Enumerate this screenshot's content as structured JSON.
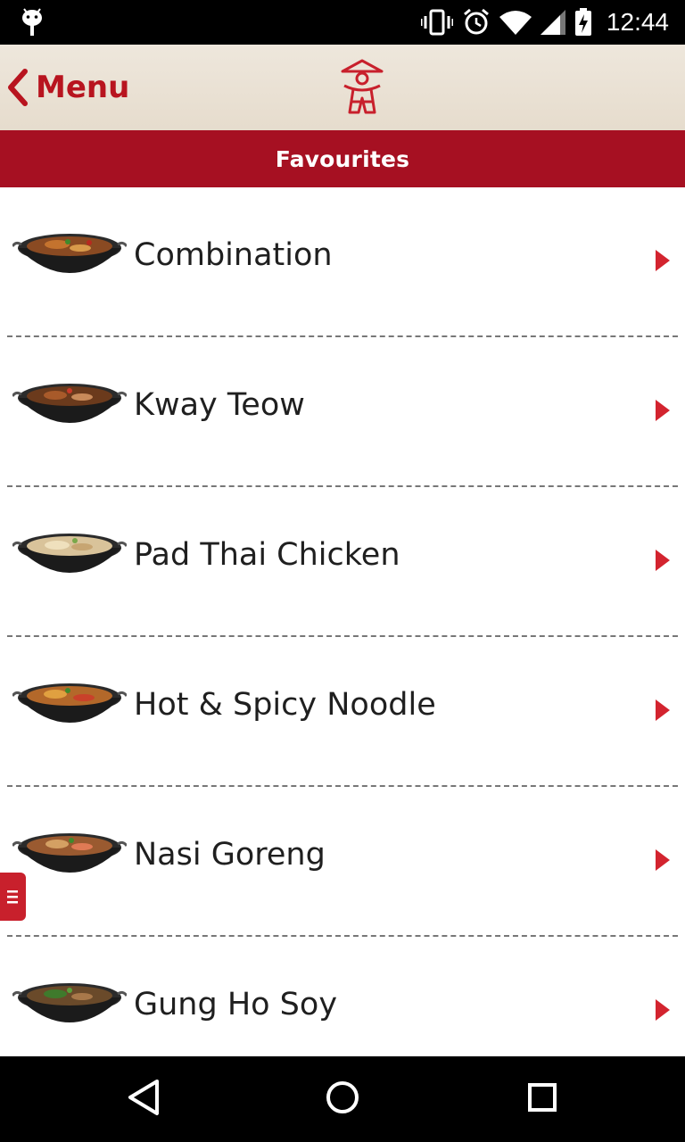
{
  "status_bar": {
    "time": "12:44",
    "icons": [
      "android-debug-icon",
      "vibrate-icon",
      "alarm-icon",
      "wifi-icon",
      "signal-icon",
      "battery-charging-icon"
    ]
  },
  "header": {
    "back_label": "Menu",
    "back_icon": "chevron-left-icon",
    "logo_icon": "chef-logo-icon",
    "accent_color": "#b8141f"
  },
  "section": {
    "title": "Favourites",
    "background_color": "#a61022"
  },
  "items": [
    {
      "label": "Combination",
      "icon": "wok-dish-icon"
    },
    {
      "label": "Kway Teow",
      "icon": "wok-dish-icon"
    },
    {
      "label": "Pad Thai Chicken",
      "icon": "wok-dish-icon"
    },
    {
      "label": "Hot & Spicy Noodle",
      "icon": "wok-dish-icon"
    },
    {
      "label": "Nasi Goreng",
      "icon": "wok-dish-icon"
    },
    {
      "label": "Gung Ho Soy",
      "icon": "wok-dish-icon"
    }
  ],
  "side_tab": {
    "icon": "menu-lines-icon"
  },
  "nav_bar": {
    "buttons": [
      "back-triangle-icon",
      "home-circle-icon",
      "recents-square-icon"
    ]
  }
}
